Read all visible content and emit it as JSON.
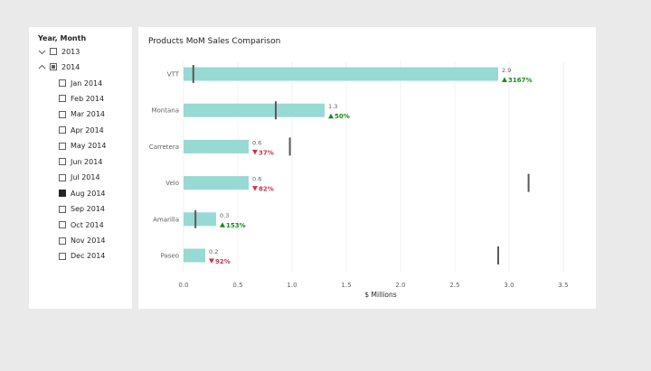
{
  "slicer": {
    "title": "Year, Month",
    "years": [
      {
        "label": "2013",
        "expanded": false,
        "state": "unchecked"
      },
      {
        "label": "2014",
        "expanded": true,
        "state": "partial"
      }
    ],
    "months": [
      {
        "label": "Jan 2014",
        "checked": false
      },
      {
        "label": "Feb 2014",
        "checked": false
      },
      {
        "label": "Mar 2014",
        "checked": false
      },
      {
        "label": "Apr 2014",
        "checked": false
      },
      {
        "label": "May 2014",
        "checked": false
      },
      {
        "label": "Jun 2014",
        "checked": false
      },
      {
        "label": "Jul 2014",
        "checked": false
      },
      {
        "label": "Aug 2014",
        "checked": true
      },
      {
        "label": "Sep 2014",
        "checked": false
      },
      {
        "label": "Oct 2014",
        "checked": false
      },
      {
        "label": "Nov 2014",
        "checked": false
      },
      {
        "label": "Dec 2014",
        "checked": false
      }
    ]
  },
  "chart": {
    "title": "Products MoM Sales Comparison"
  },
  "chart_data": {
    "type": "bar",
    "orientation": "horizontal",
    "title": "Products MoM Sales Comparison",
    "xlabel": "$ Millions",
    "ylabel": "",
    "xlim": [
      0,
      3.5
    ],
    "xticks": [
      "0.0",
      "0.5",
      "1.0",
      "1.5",
      "2.0",
      "2.5",
      "3.0",
      "3.5"
    ],
    "xtick_values": [
      0,
      0.5,
      1.0,
      1.5,
      2.0,
      2.5,
      3.0,
      3.5
    ],
    "grid": true,
    "categories": [
      "VTT",
      "Montana",
      "Carretera",
      "Velo",
      "Amarilla",
      "Paseo"
    ],
    "values": [
      2.9,
      1.3,
      0.6,
      0.6,
      0.3,
      0.2
    ],
    "value_labels": [
      "2.9",
      "1.3",
      "0.6",
      "0.6",
      "0.3",
      "0.2"
    ],
    "previous_month": [
      0.09,
      0.85,
      0.98,
      3.18,
      0.11,
      2.9
    ],
    "change_labels": [
      "3167%",
      "50%",
      "37%",
      "82%",
      "153%",
      "92%"
    ],
    "change_direction": [
      "up",
      "up",
      "down",
      "down",
      "up",
      "down"
    ],
    "colors": {
      "bar": "#97d9d3",
      "marker": "#5a5a5a",
      "up": "#1a8a1a",
      "down": "#d1334a"
    }
  }
}
